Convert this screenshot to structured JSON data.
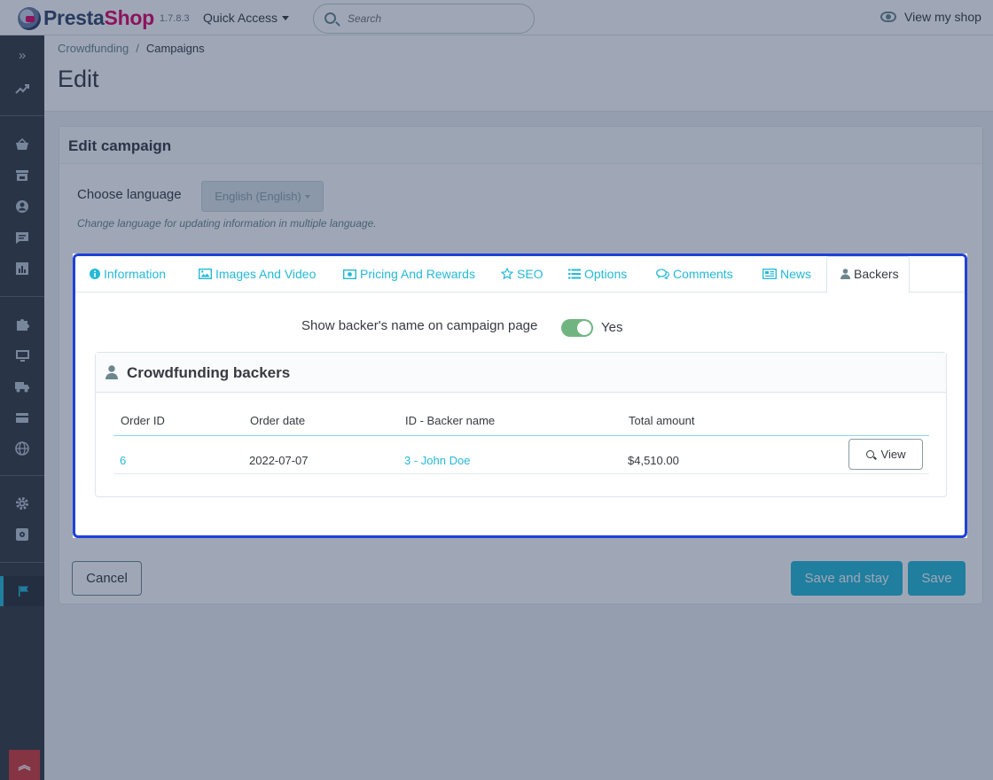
{
  "header": {
    "logo_main": "Presta",
    "logo_accent": "Shop",
    "version": "1.7.8.3",
    "quick_access": "Quick Access",
    "search_placeholder": "Search",
    "view_shop": "View my shop"
  },
  "sidebar": {
    "icons": [
      "chevron-double-right-icon",
      "trending-up-icon",
      "basket-icon",
      "store-icon",
      "user-icon",
      "comment-icon",
      "chart-icon",
      "puzzle-icon",
      "monitor-icon",
      "truck-icon",
      "credit-card-icon",
      "globe-icon",
      "gear-icon",
      "gear-box-icon",
      "flag-icon"
    ],
    "active": "flag-icon"
  },
  "breadcrumb": {
    "parent": "Crowdfunding",
    "current": "Campaigns"
  },
  "page_title": "Edit",
  "panel": {
    "title": "Edit campaign",
    "language_label": "Choose language",
    "language_value": "English (English)",
    "language_help": "Change language for updating information in multiple language."
  },
  "tabs": [
    {
      "label": "Information",
      "icon": "info-circle-icon"
    },
    {
      "label": "Images And Video",
      "icon": "image-icon"
    },
    {
      "label": "Pricing And Rewards",
      "icon": "money-icon"
    },
    {
      "label": "SEO",
      "icon": "star-icon"
    },
    {
      "label": "Options",
      "icon": "list-icon"
    },
    {
      "label": "Comments",
      "icon": "comments-icon"
    },
    {
      "label": "News",
      "icon": "newspaper-icon"
    },
    {
      "label": "Backers",
      "icon": "user-icon"
    }
  ],
  "active_tab": "Backers",
  "backers": {
    "show_name_label": "Show backer's name on campaign page",
    "show_name_value": "Yes",
    "card_title": "Crowdfunding backers",
    "columns": [
      "Order ID",
      "Order date",
      "ID - Backer name",
      "Total amount"
    ],
    "rows": [
      {
        "order_id": "6",
        "order_date": "2022-07-07",
        "backer": "3 - John Doe",
        "total": "$4,510.00",
        "action": "View"
      }
    ]
  },
  "footer": {
    "cancel": "Cancel",
    "save_and_stay": "Save and stay",
    "save": "Save"
  },
  "colors": {
    "accent": "#25b9d7",
    "highlight_border": "#1f40d8",
    "toggle_on": "#70b580",
    "sidebar_bg": "#363a41",
    "brand_pink": "#df0067"
  }
}
